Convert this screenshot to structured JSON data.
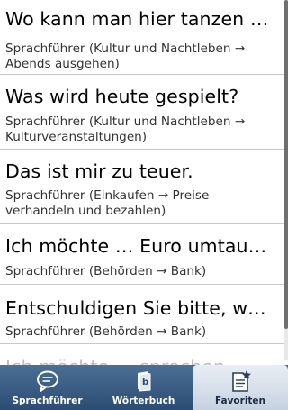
{
  "items": [
    {
      "phrase": "Wo kann man hier tanzen …",
      "category": "Sprachführer (Kultur und Nachtleben → Abends ausgehen)"
    },
    {
      "phrase": "Was wird heute gespielt?",
      "category": "Sprachführer (Kultur und Nachtleben → Kulturveranstaltungen)"
    },
    {
      "phrase": "Das ist mir zu teuer.",
      "category": "Sprachführer (Einkaufen → Preise verhandeln und bezahlen)"
    },
    {
      "phrase": "Ich möchte … Euro umtau…",
      "category": "Sprachführer (Behörden → Bank)"
    },
    {
      "phrase": "Entschuldigen Sie bitte, w…",
      "category": "Sprachführer (Behörden → Bank)"
    },
    {
      "phrase": "Ich möchte … sprechen.",
      "category": ""
    }
  ],
  "tabs": [
    {
      "label": "Sprachführer",
      "icon": "speech-bubble-icon",
      "active": false
    },
    {
      "label": "Wörterbuch",
      "icon": "dictionary-book-icon",
      "active": false
    },
    {
      "label": "Favoriten",
      "icon": "favorites-document-star-icon",
      "active": true
    }
  ],
  "colors": {
    "tabbar": "#3a5c82",
    "tab_active": "#dde5ee",
    "divider": "#c9c9c9",
    "scroll_thumb": "#6f6f6f"
  }
}
